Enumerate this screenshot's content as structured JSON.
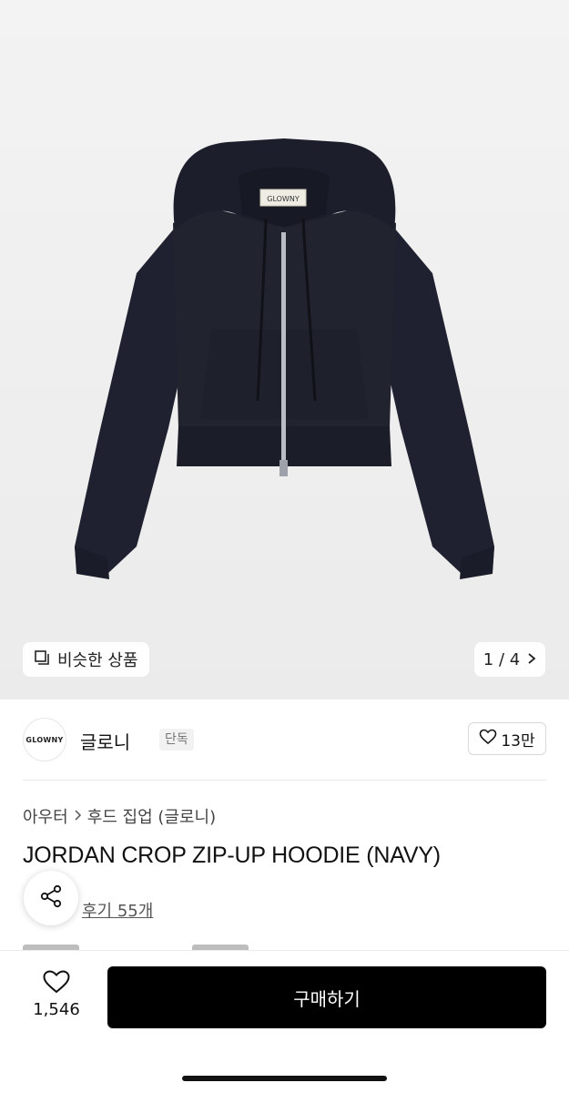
{
  "hero": {
    "label_text": "GLOWNY",
    "similar_label": "비슷한 상품",
    "counter": "1 / 4"
  },
  "brand": {
    "logo_text": "GLOWNY",
    "name": "글로니",
    "badge": "단독",
    "likes": "13만"
  },
  "product": {
    "breadcrumb_category": "아우터",
    "breadcrumb_sub": "후드 집업 (글로니)",
    "title": "JORDAN CROP ZIP-UP HOODIE (NAVY)",
    "reviews": "후기 55개"
  },
  "bottom": {
    "wish_count": "1,546",
    "buy_label": "구매하기"
  },
  "colors": {
    "hoodie": "#1f2130",
    "buy_button": "#000000"
  },
  "icons": [
    "similar-icon",
    "chevron-right-icon",
    "heart-icon",
    "share-icon"
  ]
}
